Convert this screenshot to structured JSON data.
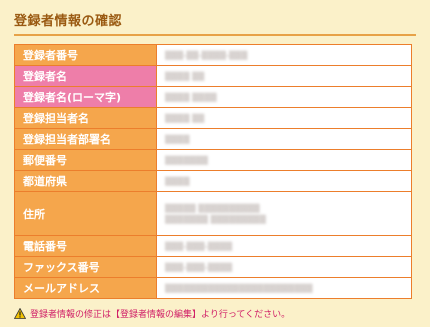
{
  "page": {
    "title": "登録者情報の確認"
  },
  "colors": {
    "label_bg": "#F5A64C",
    "label_highlight_bg": "#EE7EA9",
    "border": "#EC7E2C",
    "page_bg": "#FBF1C9",
    "note_text": "#D01E67",
    "title_text": "#9A5A12"
  },
  "rows": [
    {
      "label": "登録者番号",
      "value": "▒▒▒-▒▒-▒▒▒▒-▒▒▒"
    },
    {
      "label": "登録者名",
      "value": "▒▒▒▒ ▒▒"
    },
    {
      "label": "登録者名(ローマ字)",
      "value": "▒▒▒▒ ▒▒▒▒"
    },
    {
      "label": "登録担当者名",
      "value": "▒▒▒▒ ▒▒"
    },
    {
      "label": "登録担当者部署名",
      "value": "▒▒▒▒"
    },
    {
      "label": "郵便番号",
      "value": "▒▒▒▒▒▒▒"
    },
    {
      "label": "都道府県",
      "value": "▒▒▒▒"
    },
    {
      "label": "住所",
      "value": "▒▒▒▒▒ ▒▒▒▒▒▒▒▒▒▒",
      "value2": "▒▒▒▒▒▒▒ ▒▒▒▒▒▒▒▒▒"
    },
    {
      "label": "電話番号",
      "value": "▒▒▒-▒▒▒-▒▒▒▒"
    },
    {
      "label": "ファックス番号",
      "value": "▒▒▒-▒▒▒-▒▒▒▒"
    },
    {
      "label": "メールアドレス",
      "value": "▒▒▒▒▒▒▒▒▒▒▒▒▒▒▒▒▒▒▒▒▒▒▒▒"
    }
  ],
  "note": {
    "icon": "warning-icon",
    "text": "登録者情報の修正は【登録者情報の編集】より行ってください。"
  }
}
